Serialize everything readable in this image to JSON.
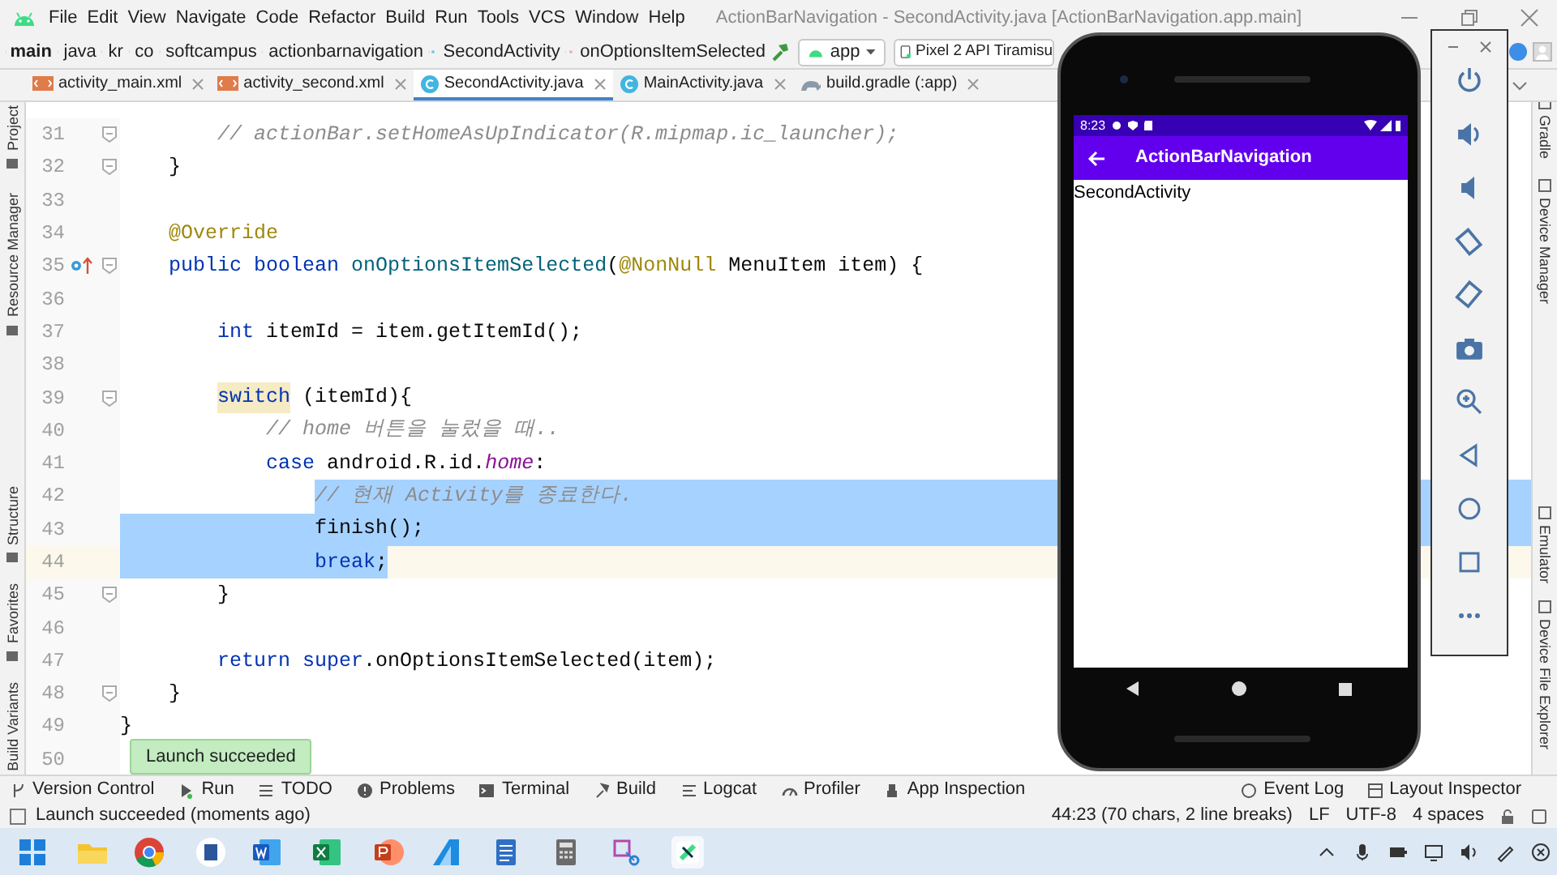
{
  "window": {
    "title": "ActionBarNavigation - SecondActivity.java [ActionBarNavigation.app.main]"
  },
  "menu": [
    "File",
    "Edit",
    "View",
    "Navigate",
    "Code",
    "Refactor",
    "Build",
    "Run",
    "Tools",
    "VCS",
    "Window",
    "Help"
  ],
  "breadcrumbs": [
    {
      "label": "main",
      "kind": "root"
    },
    {
      "label": "java",
      "kind": "folder"
    },
    {
      "label": "kr",
      "kind": "folder"
    },
    {
      "label": "co",
      "kind": "folder"
    },
    {
      "label": "softcampus",
      "kind": "folder"
    },
    {
      "label": "actionbarnavigation",
      "kind": "folder"
    },
    {
      "label": "SecondActivity",
      "kind": "class"
    },
    {
      "label": "onOptionsItemSelected",
      "kind": "method"
    }
  ],
  "run_config": {
    "module": "app",
    "device": "Pixel 2 API Tiramisu"
  },
  "tabs": [
    {
      "label": "activity_main.xml",
      "kind": "xml",
      "selected": false
    },
    {
      "label": "activity_second.xml",
      "kind": "xml",
      "selected": false
    },
    {
      "label": "SecondActivity.java",
      "kind": "class",
      "selected": true
    },
    {
      "label": "MainActivity.java",
      "kind": "class",
      "selected": false
    },
    {
      "label": "build.gradle (:app)",
      "kind": "gradle",
      "selected": false
    }
  ],
  "left_tools": [
    "Project",
    "Resource Manager",
    "Structure",
    "Favorites",
    "Build Variants"
  ],
  "right_tools": [
    "Gradle",
    "Device Manager",
    "Emulator",
    "Device File Explorer"
  ],
  "code": [
    {
      "number": "31",
      "kind": "plain",
      "fold": true,
      "overridden": false,
      "current": false,
      "tokens": [
        {
          "kind": "comment",
          "text": "        // actionBar.setHomeAsUpIndicator(R.mipmap.ic_launcher);"
        }
      ]
    },
    {
      "number": "32",
      "kind": "plain",
      "fold": true,
      "overridden": false,
      "current": false,
      "tokens": [
        {
          "kind": "plain",
          "text": "    }"
        }
      ]
    },
    {
      "number": "33",
      "kind": "plain",
      "fold": false,
      "overridden": false,
      "current": false
    },
    {
      "number": "34",
      "kind": "plain",
      "fold": false,
      "overridden": false,
      "current": false,
      "tokens": [
        {
          "kind": "annotation",
          "text": "    @Override"
        }
      ]
    },
    {
      "number": "35",
      "kind": "plain",
      "fold": true,
      "overridden": true,
      "current": false,
      "tokens": [
        {
          "kind": "keyword",
          "text": "    public "
        },
        {
          "kind": "keyword",
          "text": "boolean "
        },
        {
          "kind": "method",
          "text": "onOptionsItemSelected"
        },
        {
          "kind": "plain",
          "text": "("
        },
        {
          "kind": "annotation",
          "text": "@NonNull"
        },
        {
          "kind": "plain",
          "text": " MenuItem item) {"
        }
      ]
    },
    {
      "number": "36",
      "kind": "plain",
      "fold": false,
      "overridden": false,
      "current": false
    },
    {
      "number": "37",
      "kind": "plain",
      "fold": false,
      "overridden": false,
      "current": false,
      "tokens": [
        {
          "kind": "keyword",
          "text": "        int "
        },
        {
          "kind": "plain",
          "text": "itemId = item.getItemId();"
        }
      ]
    },
    {
      "number": "38",
      "kind": "plain",
      "fold": false,
      "overridden": false,
      "current": false
    },
    {
      "number": "39",
      "kind": "plain",
      "fold": true,
      "overridden": false,
      "current": false,
      "tokens": [
        {
          "kind": "keyword_match",
          "text": "        switch"
        },
        {
          "kind": "plain",
          "text": " (itemId){"
        }
      ]
    },
    {
      "number": "40",
      "kind": "plain",
      "fold": false,
      "overridden": false,
      "current": false,
      "tokens": [
        {
          "kind": "comment",
          "text": "            // home 버튼을 눌렀을 때.."
        }
      ]
    },
    {
      "number": "41",
      "kind": "plain",
      "fold": false,
      "overridden": false,
      "current": false,
      "tokens": [
        {
          "kind": "keyword",
          "text": "            case "
        },
        {
          "kind": "plain",
          "text": "android.R.id."
        },
        {
          "kind": "field",
          "text": "home"
        },
        {
          "kind": "plain",
          "text": ":"
        }
      ]
    },
    {
      "number": "42",
      "kind": "selection_tail",
      "fold": false,
      "overridden": false,
      "current": false,
      "tokens": [
        {
          "kind": "comment",
          "text": "                // 현재 Activity를 종료한다."
        }
      ]
    },
    {
      "number": "43",
      "kind": "selection_full",
      "fold": false,
      "overridden": false,
      "current": false,
      "tokens": [
        {
          "kind": "plain",
          "text": "                finish();"
        }
      ]
    },
    {
      "number": "44",
      "kind": "selection_head",
      "fold": false,
      "overridden": false,
      "current": true,
      "tokens": [
        {
          "kind": "keyword",
          "text": "                break"
        },
        {
          "kind": "plain",
          "text": ";"
        }
      ]
    },
    {
      "number": "45",
      "kind": "plain",
      "fold": true,
      "overridden": false,
      "current": false,
      "tokens": [
        {
          "kind": "plain",
          "text": "        }"
        }
      ]
    },
    {
      "number": "46",
      "kind": "plain",
      "fold": false,
      "overridden": false,
      "current": false
    },
    {
      "number": "47",
      "kind": "plain",
      "fold": false,
      "overridden": false,
      "current": false,
      "tokens": [
        {
          "kind": "keyword",
          "text": "        return "
        },
        {
          "kind": "keyword",
          "text": "super"
        },
        {
          "kind": "plain",
          "text": ".onOptionsItemSelected(item);"
        }
      ]
    },
    {
      "number": "48",
      "kind": "plain",
      "fold": true,
      "overridden": false,
      "current": false,
      "tokens": [
        {
          "kind": "plain",
          "text": "    }"
        }
      ]
    },
    {
      "number": "49",
      "kind": "plain",
      "fold": false,
      "overridden": false,
      "current": false,
      "tokens": [
        {
          "kind": "plain",
          "text": "}"
        }
      ]
    },
    {
      "number": "50",
      "kind": "plain",
      "fold": false,
      "overridden": false,
      "current": false
    }
  ],
  "toast": "Launch succeeded",
  "bottom_tools": [
    {
      "label": "Version Control",
      "kind": "vcs"
    },
    {
      "label": "Run",
      "kind": "run"
    },
    {
      "label": "TODO",
      "kind": "todo"
    },
    {
      "label": "Problems",
      "kind": "problems"
    },
    {
      "label": "Terminal",
      "kind": "terminal"
    },
    {
      "label": "Build",
      "kind": "build"
    },
    {
      "label": "Logcat",
      "kind": "logcat"
    },
    {
      "label": "Profiler",
      "kind": "profiler"
    },
    {
      "label": "App Inspection",
      "kind": "inspection"
    }
  ],
  "bottom_tools_right": [
    {
      "label": "Event Log",
      "kind": "log"
    },
    {
      "label": "Layout Inspector",
      "kind": "layout"
    }
  ],
  "status": {
    "message": "Launch succeeded (moments ago)",
    "position": "44:23 (70 chars, 2 line breaks)",
    "line_separator": "LF",
    "encoding": "UTF-8",
    "indent": "4 spaces"
  },
  "emulator": {
    "time": "8:23",
    "app_title": "ActionBarNavigation",
    "content": "SecondActivity"
  }
}
